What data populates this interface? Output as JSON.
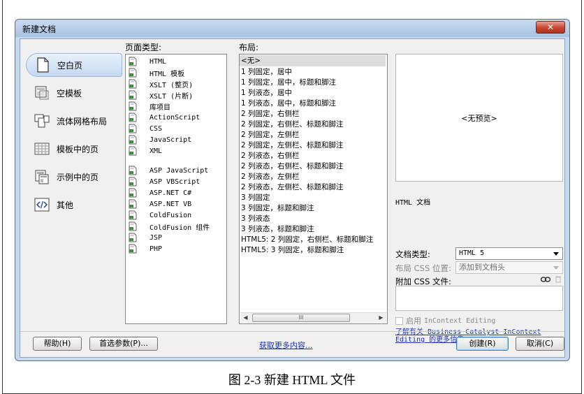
{
  "dialog": {
    "title": "新建文档",
    "close_glyph": "✕"
  },
  "categories": [
    {
      "label": "空白页",
      "icon": "blank-page-icon",
      "selected": true
    },
    {
      "label": "空模板",
      "icon": "blank-template-icon",
      "selected": false
    },
    {
      "label": "流体网格布局",
      "icon": "fluid-grid-icon",
      "selected": false
    },
    {
      "label": "模板中的页",
      "icon": "page-from-template-icon",
      "selected": false
    },
    {
      "label": "示例中的页",
      "icon": "page-from-sample-icon",
      "selected": false
    },
    {
      "label": "其他",
      "icon": "other-code-icon",
      "selected": false
    }
  ],
  "page_type": {
    "label": "页面类型:",
    "items": [
      "HTML",
      "HTML 模板",
      "XSLT (整页)",
      "XSLT (片断)",
      "库项目",
      "ActionScript",
      "CSS",
      "JavaScript",
      "XML",
      "ASP JavaScript",
      "ASP VBScript",
      "ASP.NET C#",
      "ASP.NET VB",
      "ColdFusion",
      "ColdFusion 组件",
      "JSP",
      "PHP"
    ]
  },
  "layout": {
    "label": "布局:",
    "items": [
      "<无>",
      "1 列固定，居中",
      "1 列固定，居中，标题和脚注",
      "1 列液态，居中",
      "1 列液态，居中，标题和脚注",
      "2 列固定，右侧栏",
      "2 列固定，右侧栏、标题和脚注",
      "2 列固定，左侧栏",
      "2 列固定，左侧栏、标题和脚注",
      "2 列液态，右侧栏",
      "2 列液态，右侧栏、标题和脚注",
      "2 列液态，左侧栏",
      "2 列液态，左侧栏、标题和脚注",
      "3 列固定",
      "3 列固定，标题和脚注",
      "3 列液态",
      "3 列液态，标题和脚注",
      "HTML5: 2 列固定，右侧栏、标题和脚注",
      "HTML5: 3 列固定，标题和脚注"
    ],
    "scroll_grip": "III"
  },
  "preview": {
    "placeholder": "<无预览>",
    "description": "HTML 文档"
  },
  "doc_type": {
    "label": "文档类型:",
    "value": "HTML 5"
  },
  "layout_css": {
    "label": "布局 CSS 位置:",
    "value": "添加到文档头"
  },
  "attach_css": {
    "label": "附加 CSS 文件:"
  },
  "incontext": {
    "label_cn": "启用",
    "label_en": "InContext Editing"
  },
  "help_link": "了解有关 Business Catalyst InContext Editing 的更多信息",
  "buttons": {
    "help": "帮助(H)",
    "prefs": "首选参数(P)...",
    "get_more": "获取更多内容...",
    "create": "创建(R)",
    "cancel": "取消(C)"
  },
  "caption": "图 2-3  新建 HTML 文件"
}
